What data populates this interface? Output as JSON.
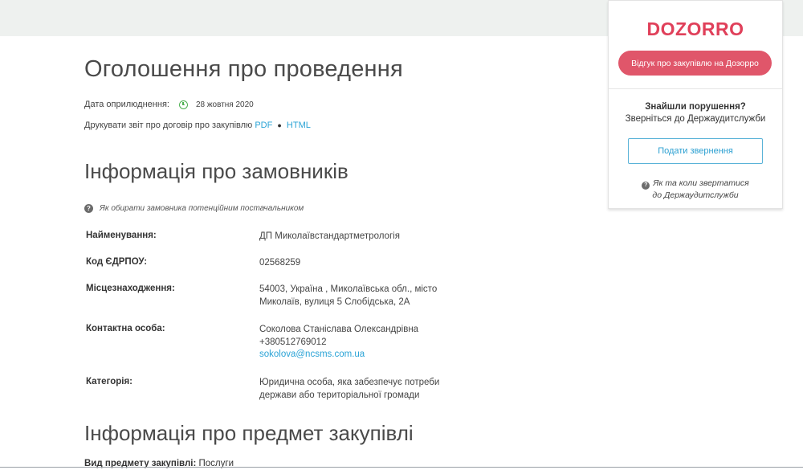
{
  "header": {
    "title": "Оголошення про проведення",
    "date_label": "Дата оприлюднення:",
    "date_value": "28 жовтня 2020",
    "print_label": "Друкувати звіт про договір про закупівлю",
    "print_pdf": "PDF",
    "print_html": "HTML",
    "icons": {
      "date": "clock-icon"
    }
  },
  "customers": {
    "title": "Інформація про замовників",
    "help_text": "Як обирати замовника потенційним постачальником",
    "rows": [
      {
        "label": "Найменування:",
        "value": "ДП Миколаївстандартметрологія"
      },
      {
        "label": "Код ЄДРПОУ:",
        "value": "02568259"
      },
      {
        "label": "Місцезнаходження:",
        "value": "54003, Україна , Миколаївська обл., місто Миколаїв, вулиця 5 Слобідська, 2А"
      },
      {
        "label": "Контактна особа:",
        "value": "Соколова Станіслава Олександрівна",
        "phone": "+380512769012",
        "email": "sokolova@ncsms.com.ua"
      },
      {
        "label": "Категорія:",
        "value": "Юридична особа, яка забезпечує потреби держави або територіальної громади"
      }
    ]
  },
  "subject": {
    "title": "Інформація про предмет закупівлі",
    "type_label": "Вид предмету закупівлі:",
    "type_value": "Послуги"
  },
  "sidebar": {
    "logo": "DOZORRO",
    "feedback_button": "Відгук про закупівлю на Дозорро",
    "found_title": "Знайшли порушення?",
    "found_sub": "Зверніться до Держаудитслужби",
    "appeal_button": "Подати звернення",
    "how_line1": "Як та коли звертатися",
    "how_line2": "до Держаудитслужби"
  },
  "colors": {
    "accent": "#2aa3d6",
    "brand": "#e0405a",
    "button": "#e0566a",
    "date_icon": "#4caf50"
  }
}
